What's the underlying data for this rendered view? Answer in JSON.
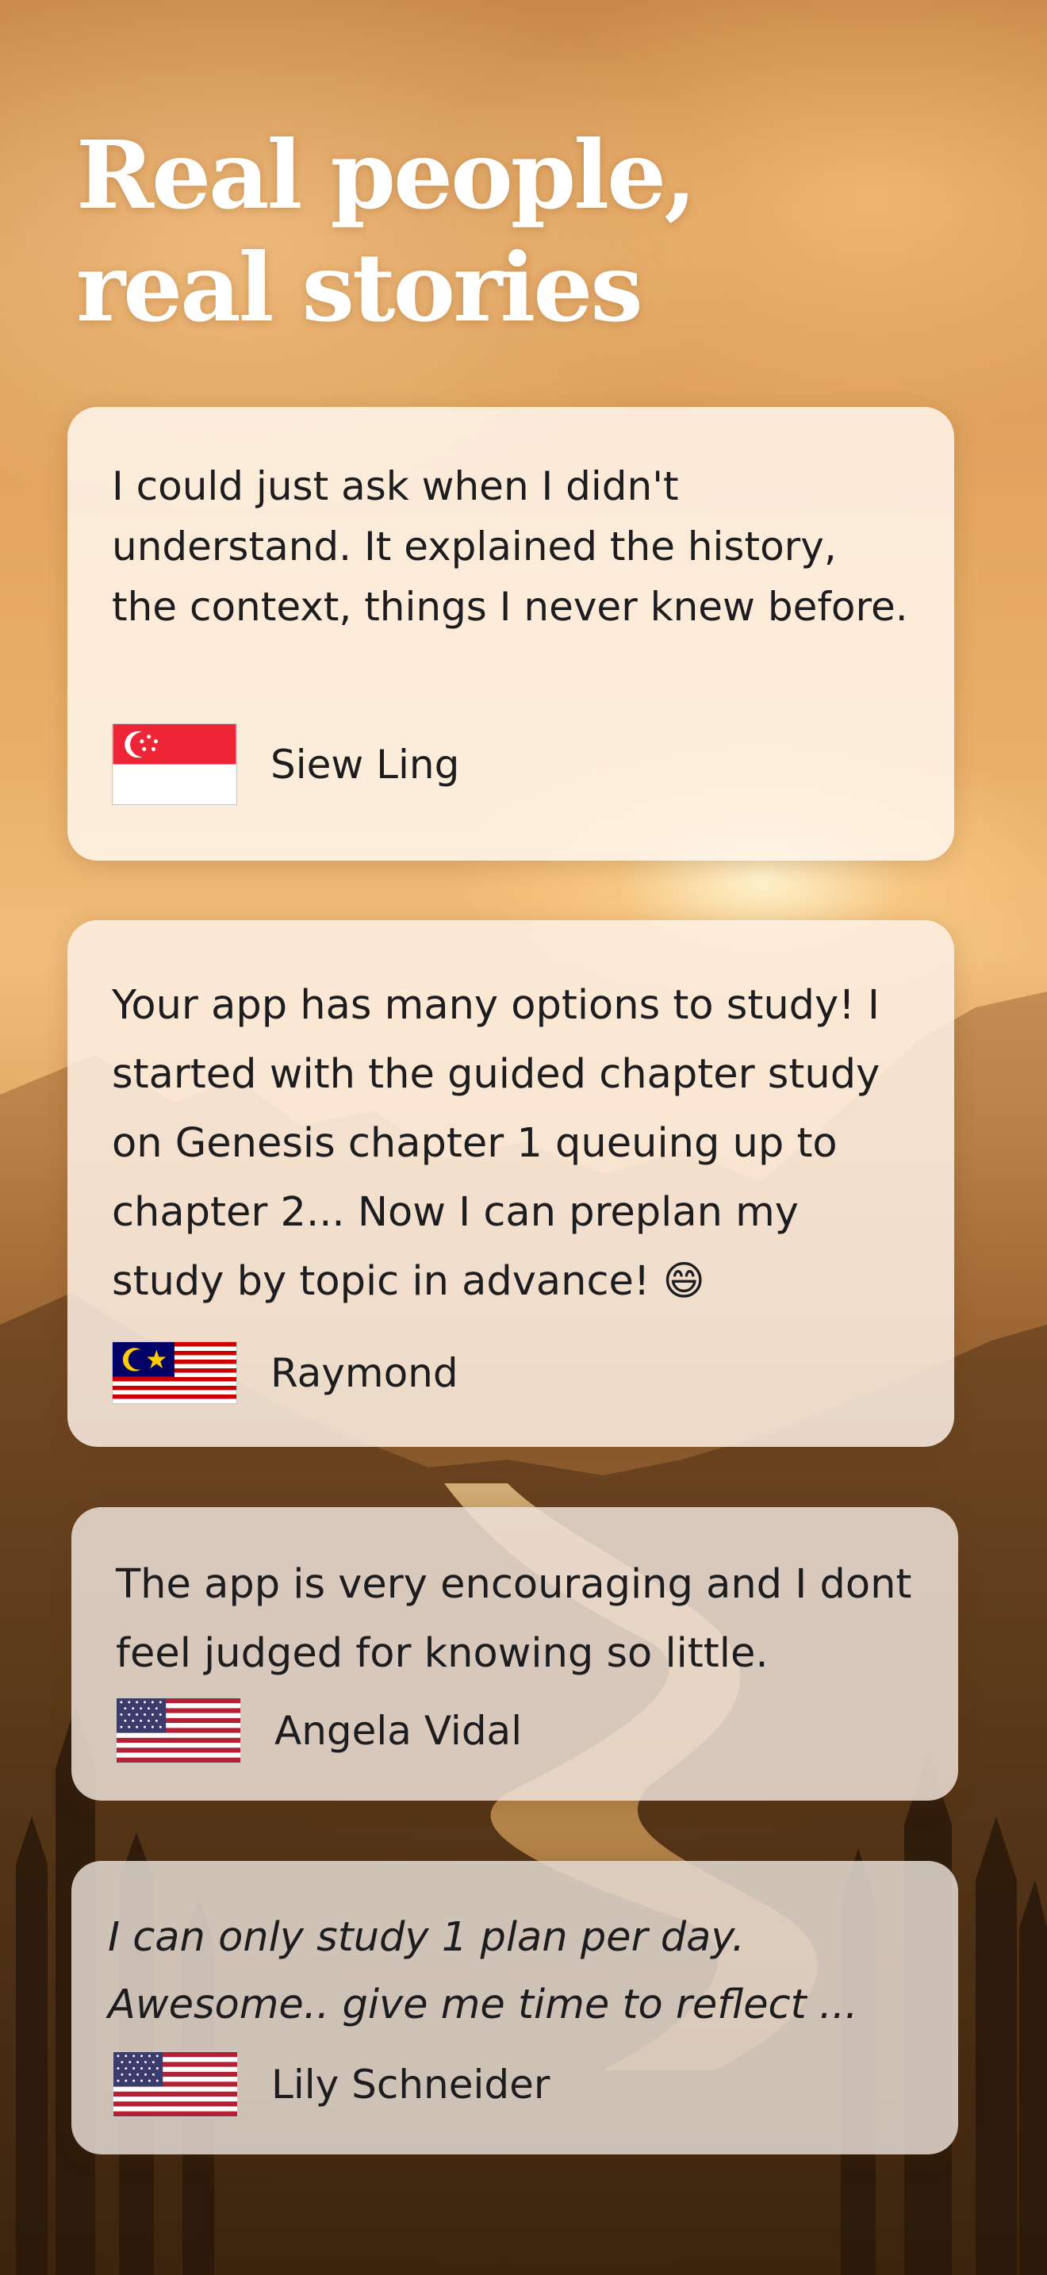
{
  "heading": {
    "line1": "Real people,",
    "line2": "real stories"
  },
  "testimonials": [
    {
      "quote": "I could just ask when I didn't understand. It explained the history, the context, things I never knew before.",
      "author": "Siew Ling",
      "flag": "singapore-flag"
    },
    {
      "quote": "Your app has many options to study! I started with the guided chapter study on Genesis chapter 1 queuing up to chapter 2... Now I can preplan my study by topic in advance! 😄",
      "author": "Raymond",
      "flag": "malaysia-flag"
    },
    {
      "quote": "The app is very encouraging and I dont feel judged for knowing so little.",
      "author": "Angela Vidal",
      "flag": "usa-flag"
    },
    {
      "quote": "I can only study 1 plan per day. Awesome.. give me time to reflect ...",
      "author": "Lily Schneider",
      "flag": "usa-flag"
    }
  ],
  "colors": {
    "card_text": "#1d1d1f",
    "heading_text": "#ffffff",
    "sky_glow": "#f0bd7b"
  }
}
